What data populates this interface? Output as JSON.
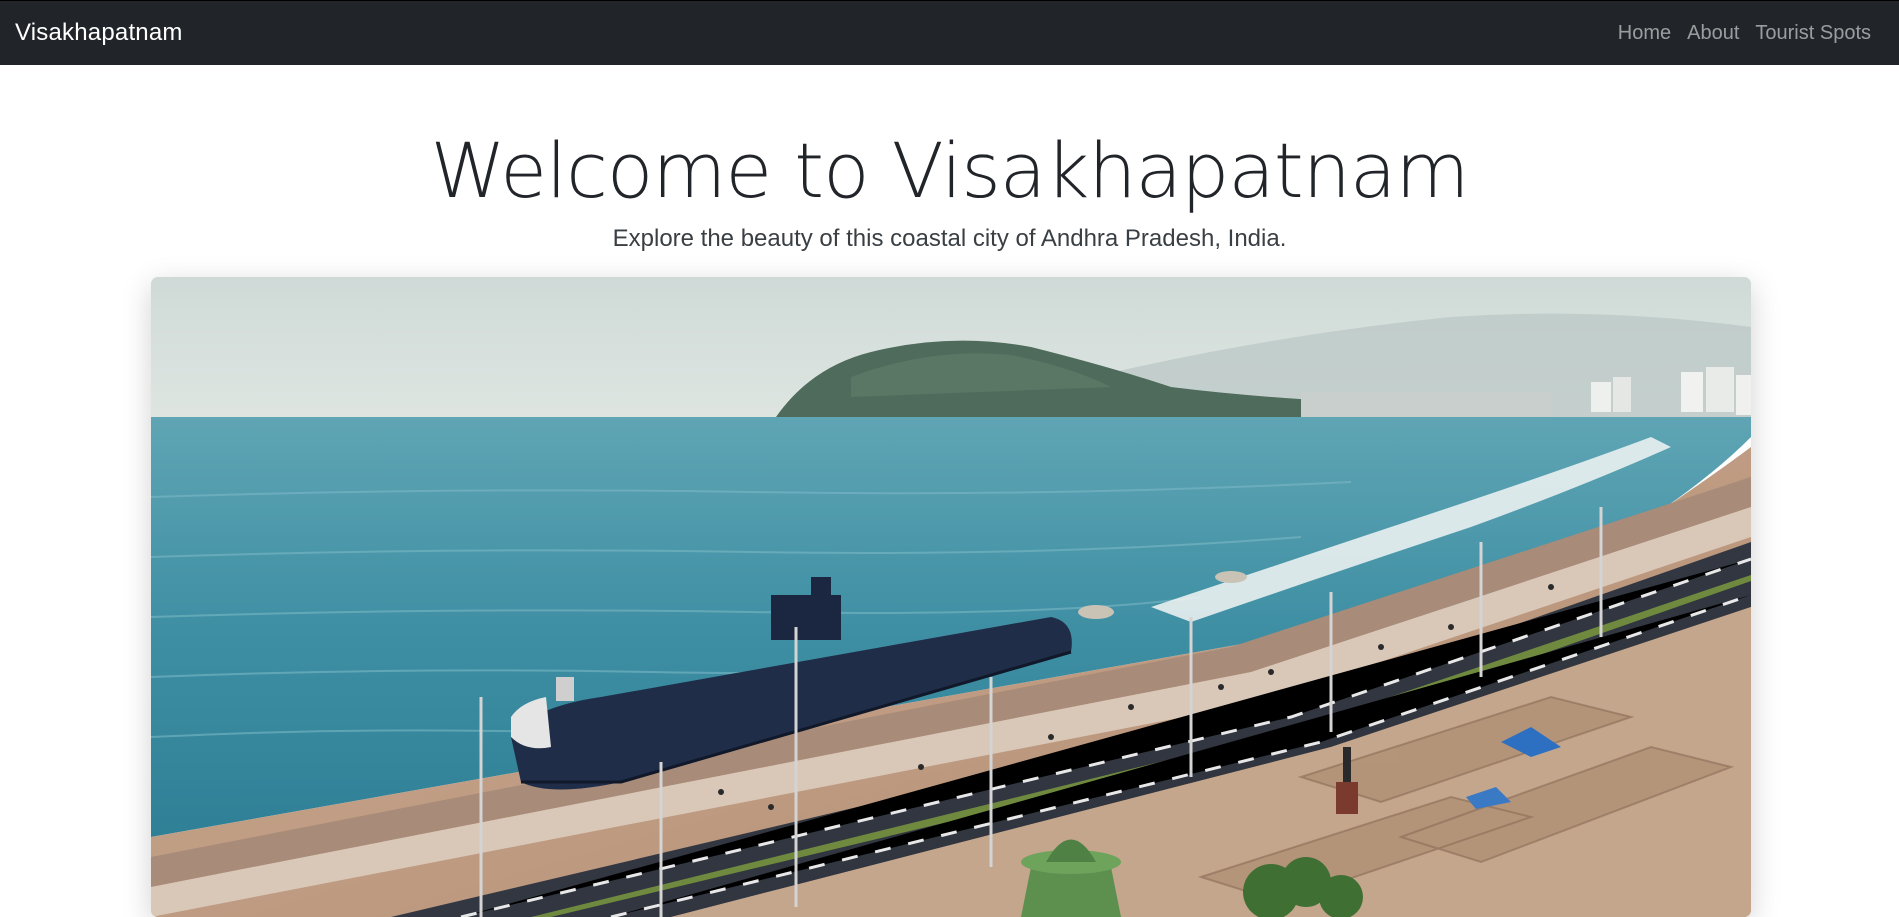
{
  "navbar": {
    "brand": "Visakhapatnam",
    "links": [
      {
        "label": "Home"
      },
      {
        "label": "About"
      },
      {
        "label": "Tourist Spots"
      }
    ]
  },
  "hero": {
    "title": "Welcome to Visakhapatnam",
    "subtitle": "Explore the beauty of this coastal city of Andhra Pradesh, India."
  },
  "colors": {
    "navbar_bg": "#212529",
    "nav_link": "rgba(255,255,255,0.55)",
    "text": "#212529"
  }
}
